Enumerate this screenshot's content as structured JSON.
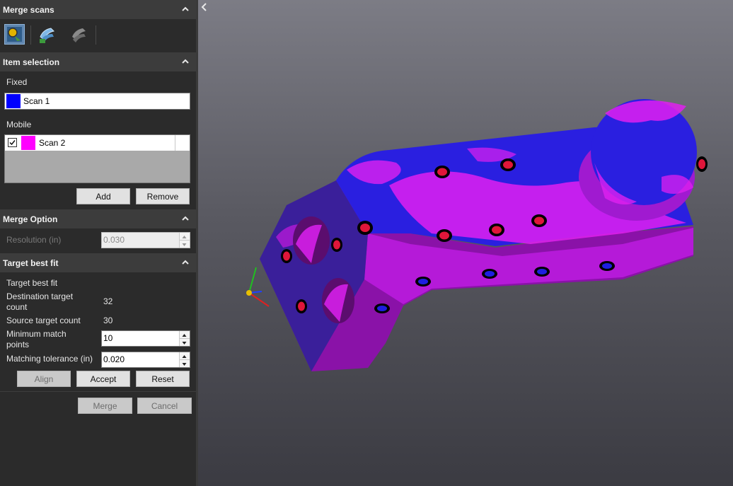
{
  "merge_scans": {
    "title": "Merge scans",
    "tools": [
      {
        "name": "manual-align-icon",
        "active": true
      },
      {
        "name": "best-fit-icon",
        "active": false
      },
      {
        "name": "target-fit-icon",
        "active": false
      }
    ]
  },
  "item_selection": {
    "title": "Item selection",
    "fixed_label": "Fixed",
    "fixed_item": {
      "name": "Scan 1",
      "color": "#0000ff"
    },
    "mobile_label": "Mobile",
    "mobile_items": [
      {
        "name": "Scan 2",
        "color": "#ff00ff",
        "checked": true
      }
    ],
    "add_label": "Add",
    "remove_label": "Remove"
  },
  "merge_option": {
    "title": "Merge Option",
    "resolution_label": "Resolution (in)",
    "resolution_value": "0.030"
  },
  "target_best_fit": {
    "title": "Target best fit",
    "subtitle": "Target best fit",
    "destination_label": "Destination target count",
    "destination_value": "32",
    "source_label": "Source target count",
    "source_value": "30",
    "min_match_label": "Minimum match points",
    "min_match_value": "10",
    "tolerance_label": "Matching tolerance (in)",
    "tolerance_value": "0.020",
    "align_label": "Align",
    "accept_label": "Accept",
    "reset_label": "Reset"
  },
  "footer": {
    "merge_label": "Merge",
    "cancel_label": "Cancel"
  },
  "colors": {
    "scan1": "#0000ff",
    "scan2": "#ff00ff",
    "target_fill": "#e0163a",
    "target_ring": "#000000"
  }
}
